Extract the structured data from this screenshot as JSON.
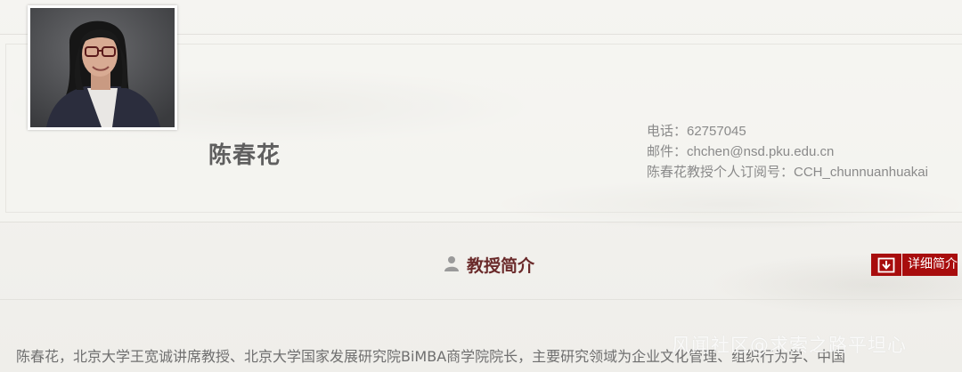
{
  "profile": {
    "name": "陈春花",
    "photo_alt": "陈春花",
    "contact": {
      "phone": "电话：62757045",
      "email": "邮件：chchen@nsd.pku.edu.cn",
      "subscription": "陈春花教授个人订阅号：CCH_chunnuanhuakai"
    }
  },
  "section": {
    "title": "教授简介",
    "icon": "person-icon",
    "detail_button": {
      "label": "详细简介",
      "icon": "download-icon"
    }
  },
  "bio": {
    "text": "陈春花，北京大学王宽诚讲席教授、北京大学国家发展研究院BiMBA商学院院长，主要研究领域为企业文化管理、组织行为学、中国"
  },
  "watermark": {
    "text": "风闻社区@求索之路平坦心"
  },
  "colors": {
    "background": "#f3f2ee",
    "title_accent": "#6a2a2a",
    "button_red": "#a80d0d",
    "text_gray": "#6f6f6f"
  }
}
